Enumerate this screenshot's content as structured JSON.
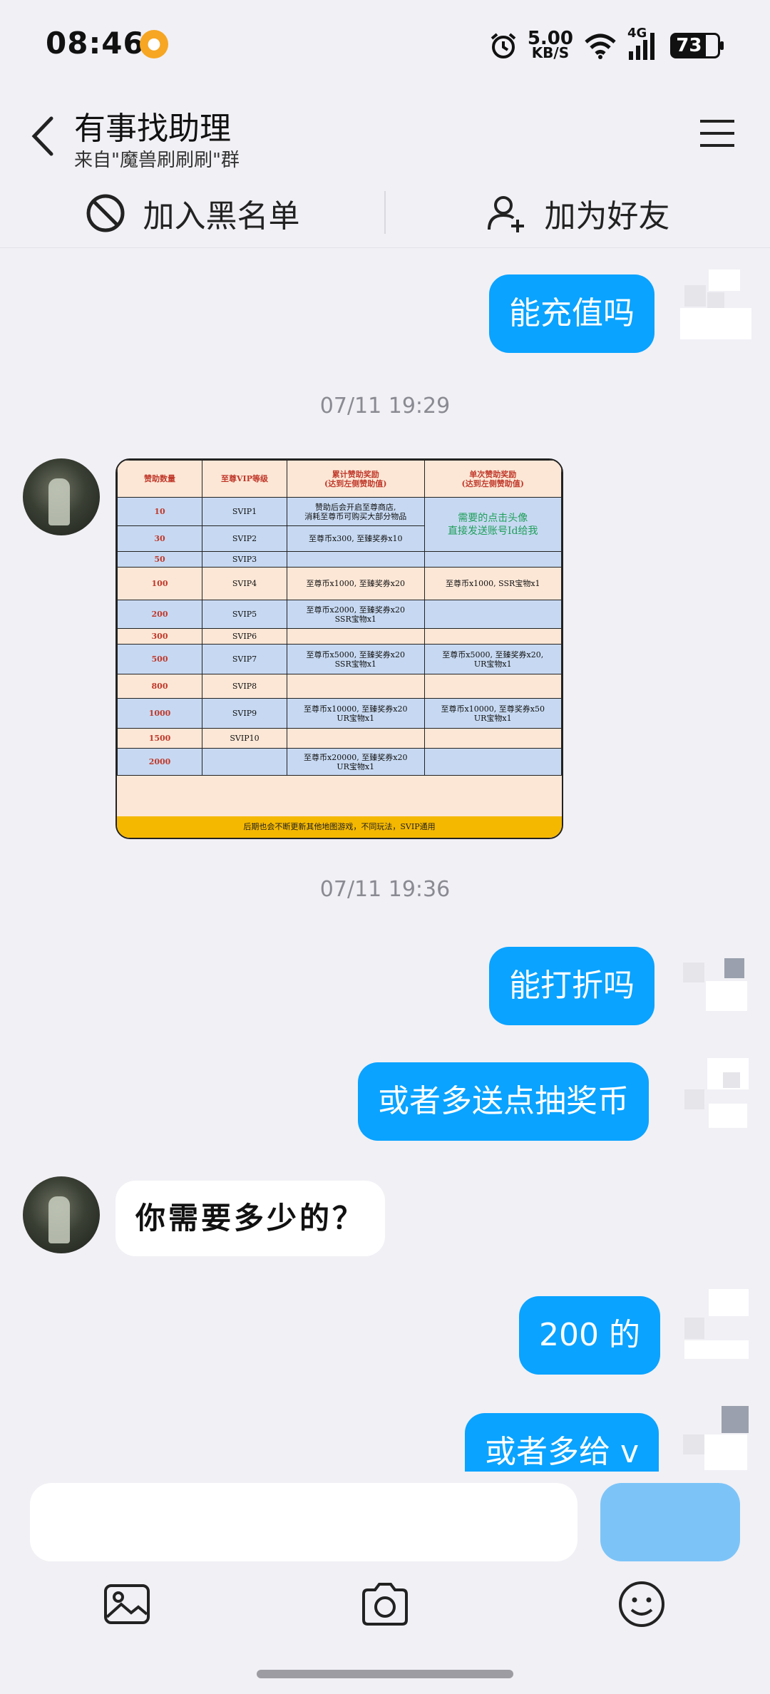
{
  "status": {
    "time": "08:46",
    "speed_value": "5.00",
    "speed_unit": "KB/S",
    "network": "4G",
    "battery": "73"
  },
  "header": {
    "title": "有事找助理",
    "subtitle": "来自\"魔兽刷刷刷\"群"
  },
  "actions": {
    "block": "加入黑名单",
    "add_friend": "加为好友"
  },
  "messages": {
    "m1": "能充值吗",
    "ts1": "07/11 19:29",
    "ts2": "07/11 19:36",
    "m2": "能打折吗",
    "m3": "或者多送点抽奖币",
    "m4": "你需要多少的？",
    "m5": "200 的",
    "m6": "或者多给 v"
  },
  "table": {
    "headers": [
      "赞助数量",
      "至尊VIP等级",
      "累计赞助奖励\n(达到左侧赞助值)",
      "单次赞助奖励\n(达到左侧赞助值)"
    ],
    "rows": [
      [
        "10",
        "SVIP1",
        "赞助后会开启至尊商店,\n消耗至尊币可购买大部分物品",
        ""
      ],
      [
        "30",
        "SVIP2",
        "至尊币x300, 至臻奖券x10",
        ""
      ],
      [
        "50",
        "SVIP3",
        "",
        ""
      ],
      [
        "100",
        "SVIP4",
        "至尊币x1000, 至臻奖券x20",
        "至尊币x1000, SSR宝物x1"
      ],
      [
        "200",
        "SVIP5",
        "至尊币x2000, 至臻奖券x20\nSSR宝物x1",
        ""
      ],
      [
        "300",
        "SVIP6",
        "",
        ""
      ],
      [
        "500",
        "SVIP7",
        "至尊币x5000, 至臻奖券x20\nSSR宝物x1",
        "至尊币x5000, 至臻奖券x20,\nUR宝物x1"
      ],
      [
        "800",
        "SVIP8",
        "",
        ""
      ],
      [
        "1000",
        "SVIP9",
        "至尊币x10000, 至臻奖券x20\nUR宝物x1",
        "至尊币x10000, 至尊奖券x50\nUR宝物x1"
      ],
      [
        "1500",
        "SVIP10",
        "",
        ""
      ],
      [
        "2000",
        "",
        "至尊币x20000, 至臻奖券x20\nUR宝物x1",
        ""
      ]
    ],
    "note": "需要的点击头像\n直接发送账号Id给我",
    "footer": "后期也会不断更新其他地图游戏，不同玩法，SVIP通用"
  }
}
